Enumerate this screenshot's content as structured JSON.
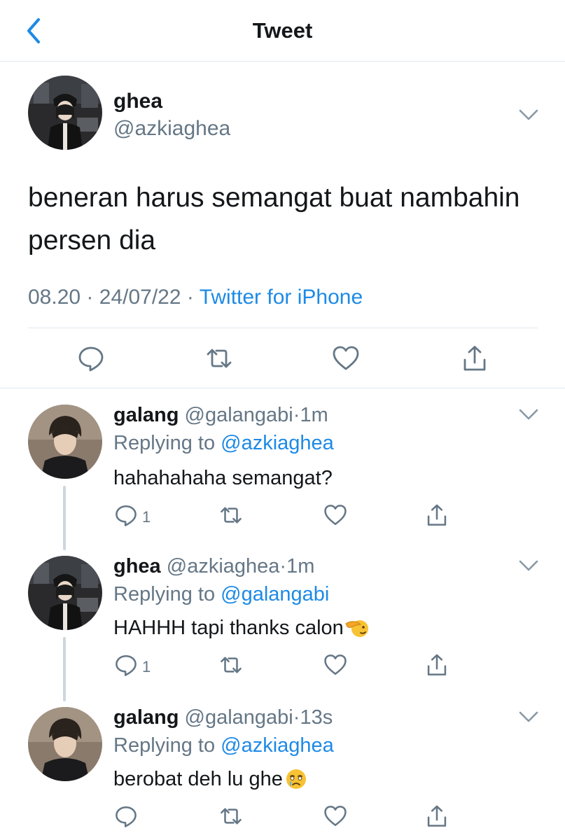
{
  "header": {
    "title": "Tweet"
  },
  "main_tweet": {
    "name": "ghea",
    "handle": "@azkiaghea",
    "text": "beneran harus semangat buat nambahin persen dia",
    "time": "08.20",
    "date": "24/07/22",
    "source": "Twitter for iPhone"
  },
  "replies": [
    {
      "name": "galang",
      "handle": "@galangabi",
      "time": "1m",
      "replying_label": "Replying to",
      "replying_to": "@azkiaghea",
      "text": "hahahahaha semangat?",
      "reply_count": "1"
    },
    {
      "name": "ghea",
      "handle": "@azkiaghea",
      "time": "1m",
      "replying_label": "Replying to",
      "replying_to": "@galangabi",
      "text": "HAHHH tapi thanks calon",
      "emoji": "saluting-face",
      "reply_count": "1"
    },
    {
      "name": "galang",
      "handle": "@galangabi",
      "time": "13s",
      "replying_label": "Replying to",
      "replying_to": "@azkiaghea",
      "text": "berobat deh lu ghe",
      "emoji": "face-holding-back-tears"
    }
  ],
  "separator": "·",
  "colors": {
    "link": "#1d8ae6",
    "muted": "#657786",
    "icon": "#657786",
    "text": "#14171a"
  }
}
